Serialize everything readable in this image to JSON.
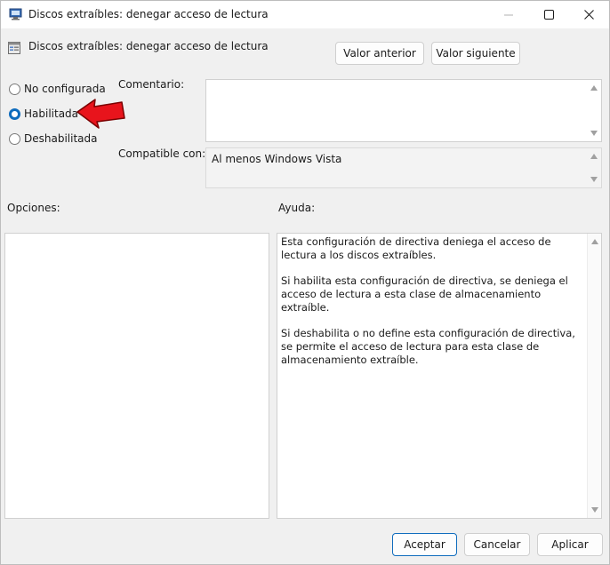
{
  "window": {
    "title": "Discos extraíbles: denegar acceso de lectura"
  },
  "header": {
    "policy_title": "Discos extraíbles: denegar acceso de lectura",
    "prev_label": "Valor anterior",
    "next_label": "Valor siguiente"
  },
  "options": [
    {
      "label": "No configurada",
      "checked": false
    },
    {
      "label": "Habilitada",
      "checked": true
    },
    {
      "label": "Deshabilitada",
      "checked": false
    }
  ],
  "comment": {
    "label": "Comentario:",
    "value": ""
  },
  "supported": {
    "label": "Compatible con:",
    "value": "Al menos Windows Vista"
  },
  "panels": {
    "options_label": "Opciones:",
    "help_label": "Ayuda:"
  },
  "help": {
    "paragraphs": [
      "Esta configuración de directiva deniega el acceso de lectura a los discos extraíbles.",
      "Si habilita esta configuración de directiva, se deniega el acceso de lectura a esta clase de almacenamiento extraíble.",
      "Si deshabilita o no define esta configuración de directiva, se permite el acceso de lectura para esta clase de almacenamiento extraíble."
    ]
  },
  "footer": {
    "ok_label": "Aceptar",
    "cancel_label": "Cancelar",
    "apply_label": "Aplicar"
  },
  "colors": {
    "accent": "#0f6cbd",
    "annotation_arrow": "#e8141c"
  }
}
